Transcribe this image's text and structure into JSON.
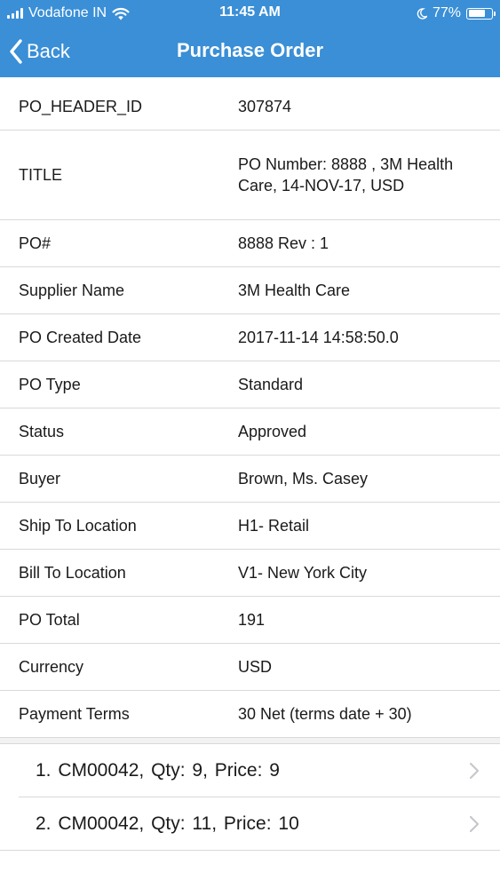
{
  "status_bar": {
    "carrier": "Vodafone IN",
    "time": "11:45 AM",
    "battery_text": "77%",
    "battery_level": 0.77,
    "icons": [
      "signal-icon",
      "wifi-icon",
      "moon-icon",
      "battery-icon"
    ]
  },
  "nav": {
    "back_label": "Back",
    "title": "Purchase Order",
    "icons": [
      "chevron-left-icon"
    ]
  },
  "details": [
    {
      "label": "PO_HEADER_ID",
      "value": "307874"
    },
    {
      "label": "TITLE",
      "value": "PO Number: 8888 , 3M Health Care, 14-NOV-17, USD"
    },
    {
      "label": "PO#",
      "value": "8888 Rev : 1"
    },
    {
      "label": "Supplier Name",
      "value": "3M Health Care"
    },
    {
      "label": "PO Created Date",
      "value": "2017-11-14 14:58:50.0"
    },
    {
      "label": "PO Type",
      "value": "Standard"
    },
    {
      "label": "Status",
      "value": "Approved"
    },
    {
      "label": "Buyer",
      "value": "Brown, Ms. Casey"
    },
    {
      "label": "Ship To Location",
      "value": "H1- Retail"
    },
    {
      "label": "Bill To Location",
      "value": "V1- New York City"
    },
    {
      "label": "PO Total",
      "value": "191"
    },
    {
      "label": "Currency",
      "value": "USD"
    },
    {
      "label": "Payment Terms",
      "value": "30 Net (terms date + 30)"
    }
  ],
  "line_items": [
    {
      "text": "1.  CM00042, Qty:  9, Price:  9"
    },
    {
      "text": "2.  CM00042, Qty:  11, Price:  10"
    }
  ],
  "colors": {
    "header_blue": "#3a8fd6",
    "divider": "#d9d9d9",
    "text": "#1a1a1a",
    "chevron": "#c7c7cc"
  }
}
